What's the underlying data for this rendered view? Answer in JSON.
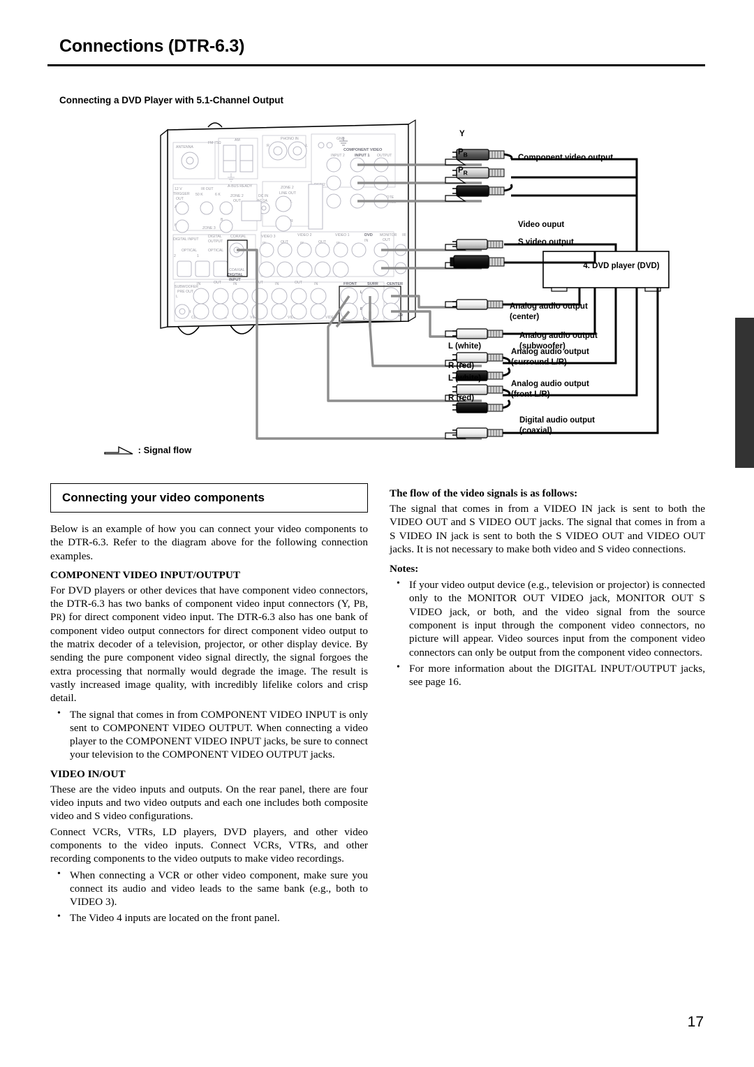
{
  "header": {
    "title": "Connections (DTR-6.3)",
    "subheading": "Connecting a DVD Player with 5.1-Channel Output"
  },
  "page_number": "17",
  "diagram": {
    "legend": ": Signal flow",
    "device_box": "4. DVD player (DVD)",
    "connector_labels": {
      "y": "Y",
      "pb_main": "P",
      "pb_sub": "B",
      "pr_main": "P",
      "pr_sub": "R",
      "left_white": "L (white)",
      "right_red": "R (red)",
      "left_white2": "L (white)",
      "right_red2": "R (red)"
    },
    "callouts": [
      "Component video output",
      "Video ouput",
      "S video output",
      "Analog audio output",
      "(center)",
      "Analog audio output",
      "(subwoofer)",
      "Analog audio output",
      "(surround L/R)",
      "Analog audio output",
      "(front L/R)",
      "Digital audio output",
      "(coaxial)"
    ],
    "rear_panel": {
      "antenna": "ANTENNA",
      "fm": "FM 75Ω",
      "am": "AM",
      "phono_in": "PHONO IN",
      "gnd": "GND",
      "component_video": "COMPONENT VIDEO",
      "input2": "INPUT 2",
      "input1": "INPUT 1",
      "output": "OUTPUT",
      "trigger": "12 V TRIGGER OUT",
      "ir_out": "IR OUT",
      "abus": "A-BUS READY",
      "zone2_out": "ZONE 2 OUT",
      "dc_in": "DC IN AC 1A",
      "zone2_line_out": "ZONE 2 LINE OUT",
      "rs232": "RS232",
      "remote_control": "REMOTE CONTROL",
      "digital_input": "DIGITAL INPUT",
      "optical": "OPTICAL",
      "digital_output": "DIGITAL OUTPUT",
      "coaxial": "COAXIAL",
      "coaxial_digital_input": "COAXIAL DIGITAL INPUT",
      "video3": "VIDEO 3",
      "video2": "VIDEO 2",
      "video1": "VIDEO 1",
      "dvd_in": "DVD IN",
      "monitor_out": "MONITOR OUT",
      "ir": "IR",
      "v": "V",
      "s": "S",
      "in": "IN",
      "out": "OUT",
      "subwoofer_pre_out": "SUBWOOFER PRE OUT",
      "cd": "CD",
      "tape": "TAPE",
      "video0": "VIDEO",
      "front": "FRONT",
      "surr": "SURR",
      "center": "CENTER",
      "sub_woofer": "SUB WOOFER",
      "dvd": "DVD",
      "l": "L",
      "r": "R",
      "a": "A",
      "b": "B",
      "zone3": "ZONE 3"
    }
  },
  "left_column": {
    "box_heading": "Connecting your video components",
    "intro": "Below is an example of how you can connect your video components to the DTR-6.3. Refer to the diagram above for the following connection examples.",
    "section1_heading": "COMPONENT VIDEO INPUT/OUTPUT",
    "section1_body_a": "For DVD players or other devices that have component video connectors, the DTR-6.3 has two banks of component video input connectors (Y, P",
    "section1_body_b": "B",
    "section1_body_c": ", P",
    "section1_body_d": "R",
    "section1_body_e": ") for direct component video input. The DTR-6.3 also has one bank of component video output connectors for direct component video output to the matrix decoder of a television, projector, or other display device. By sending the pure component video signal directly, the signal forgoes the extra processing that normally would degrade the image. The result is vastly increased image quality, with incredibly lifelike colors and crisp detail.",
    "bullet1": "The signal that comes in from COMPONENT VIDEO INPUT is only sent to COMPONENT VIDEO OUTPUT. When connecting a video player to the COMPONENT VIDEO INPUT jacks, be sure to connect your television to the COMPONENT VIDEO OUTPUT jacks.",
    "section2_heading": "VIDEO IN/OUT",
    "section2_body_1": "These are the video inputs and outputs. On the rear panel, there are four video inputs and two video outputs and each one includes both composite video and S video configurations.",
    "section2_body_2": "Connect VCRs, VTRs, LD players, DVD players, and other video components to the video inputs. Connect VCRs, VTRs, and other recording components to the video outputs to make video recordings.",
    "bullet2": "When connecting a VCR or other video component, make sure you connect its audio and video leads to the same bank (e.g., both to VIDEO 3).",
    "bullet3": "The Video 4 inputs are located on the front panel."
  },
  "right_column": {
    "flow_heading": "The flow of the video signals is as follows:",
    "flow_body": "The signal that comes in from a VIDEO IN jack is sent to both the VIDEO OUT and S VIDEO OUT jacks. The signal that comes in from a S VIDEO IN jack is sent to both the S VIDEO OUT and VIDEO OUT jacks. It is not necessary to make both video and S video connections.",
    "notes_label": "Notes:",
    "note1": "If your video output device (e.g., television or projector) is connected only to the MONITOR OUT VIDEO jack, MONITOR OUT S VIDEO jack, or both, and the video signal from the source component is input through the component video connectors, no picture will appear. Video sources input from the component video connectors can only be output from the component video connectors.",
    "note2": "For more information about the DIGITAL INPUT/OUTPUT jacks, see page 16."
  }
}
